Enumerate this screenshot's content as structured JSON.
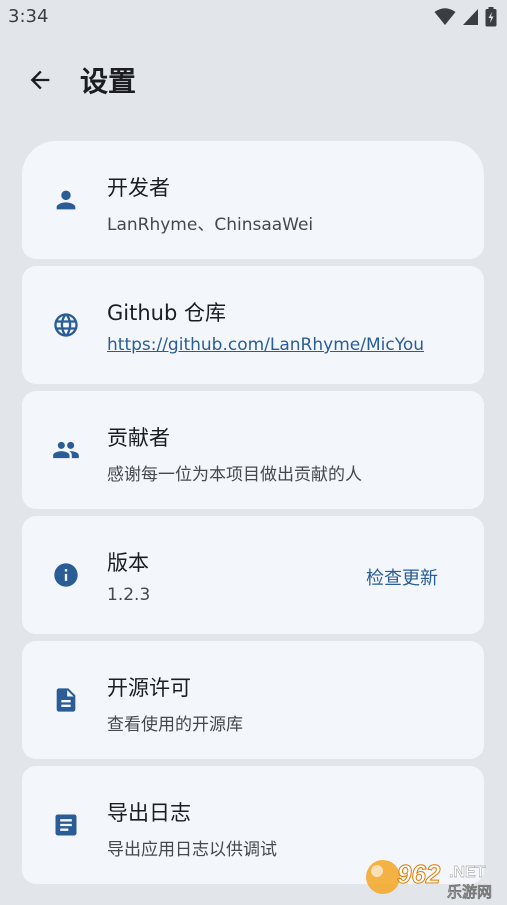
{
  "status": {
    "time": "3:34",
    "icons": [
      "wifi-icon",
      "cell-signal-icon",
      "battery-icon"
    ]
  },
  "header": {
    "back_icon": "arrow-back-icon",
    "title": "设置"
  },
  "items": [
    {
      "icon": "person-icon",
      "title": "开发者",
      "subtitle": "LanRhyme、ChinsaaWei"
    },
    {
      "icon": "globe-icon",
      "title": "Github 仓库",
      "subtitle": "https://github.com/LanRhyme/MicYou"
    },
    {
      "icon": "group-icon",
      "title": "贡献者",
      "subtitle": "感谢每一位为本项目做出贡献的人"
    },
    {
      "icon": "info-icon",
      "title": "版本",
      "subtitle": "1.2.3",
      "action": "检查更新"
    },
    {
      "icon": "description-icon",
      "title": "开源许可",
      "subtitle": "查看使用的开源库"
    },
    {
      "icon": "article-icon",
      "title": "导出日志",
      "subtitle": "导出应用日志以供调试"
    }
  ],
  "watermark": {
    "number": "962",
    "tld": ".NET",
    "site": "乐游网"
  },
  "colors": {
    "accent": "#2a5d96",
    "background": "#e2e6ea",
    "card": "#f3f7fb"
  }
}
